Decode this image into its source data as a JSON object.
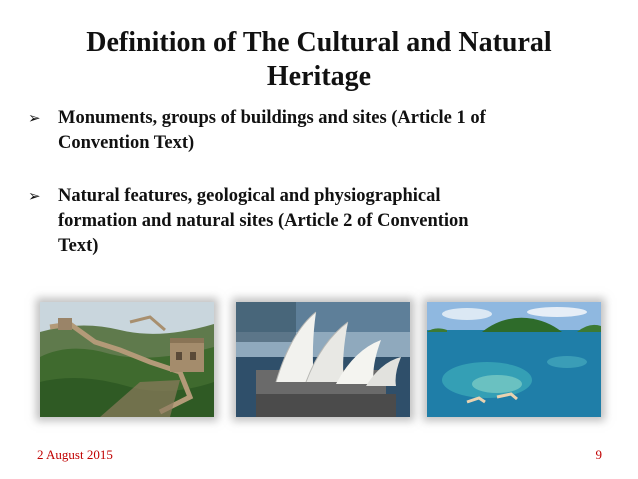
{
  "slide": {
    "title_line1": "Definition of The Cultural and Natural",
    "title_line2": "Heritage",
    "bullets": [
      {
        "line1": "Monuments, groups of buildings and sites (Article 1 of",
        "line2": "Convention Text)"
      },
      {
        "line1": "Natural features, geological and physiographical",
        "line2": "formation and natural sites (Article 2 of Convention",
        "line3": "Text)"
      }
    ],
    "bullet_glyph": "➢",
    "images": [
      "great-wall-photo",
      "sydney-opera-house-photo",
      "tropical-island-snorkel-photo"
    ]
  },
  "footer": {
    "date": "2 August 2015",
    "page_number": "9",
    "color": "#c00000"
  }
}
